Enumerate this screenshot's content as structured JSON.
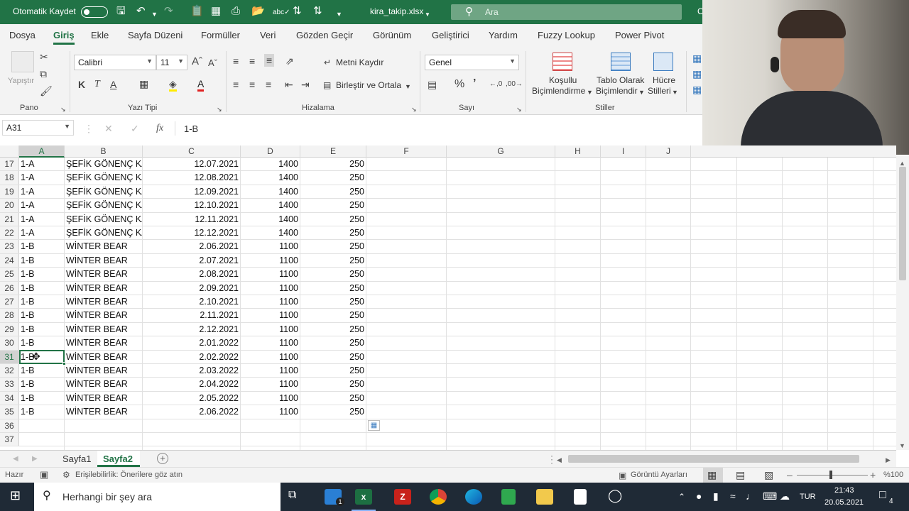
{
  "titlebar": {
    "autosave_label": "Otomatik Kaydet",
    "filename": "kira_takip.xlsx",
    "search_placeholder": "Ara",
    "overflow_char": "C"
  },
  "tabs": [
    "Dosya",
    "Giriş",
    "Ekle",
    "Sayfa Düzeni",
    "Formüller",
    "Veri",
    "Gözden Geçir",
    "Görünüm",
    "Geliştirici",
    "Yardım",
    "Fuzzy Lookup",
    "Power Pivot"
  ],
  "ribbon": {
    "paste_label": "Yapıştır",
    "font_name": "Calibri",
    "font_size": "11",
    "wrap_text": "Metni Kaydır",
    "merge_center": "Birleştir ve Ortala",
    "number_format": "Genel",
    "conditional_format_1": "Koşullu",
    "conditional_format_2": "Biçimlendirme",
    "format_table_1": "Tablo Olarak",
    "format_table_2": "Biçimlendir",
    "cell_styles_1": "Hücre",
    "cell_styles_2": "Stilleri",
    "groups": {
      "clipboard": "Pano",
      "font": "Yazı Tipi",
      "alignment": "Hizalama",
      "number": "Sayı",
      "styles": "Stiller"
    }
  },
  "formula_bar": {
    "name_box": "A31",
    "fx": "fx",
    "value": "1-B"
  },
  "columns": [
    "A",
    "B",
    "C",
    "D",
    "E",
    "F",
    "G",
    "H",
    "I",
    "J"
  ],
  "rows": [
    {
      "n": "17",
      "a": "1-A",
      "b": "ŞEFİK GÖNENÇ KA",
      "c": "12.07.2021",
      "d": "1400",
      "e": "250"
    },
    {
      "n": "18",
      "a": "1-A",
      "b": "ŞEFİK GÖNENÇ KA",
      "c": "12.08.2021",
      "d": "1400",
      "e": "250"
    },
    {
      "n": "19",
      "a": "1-A",
      "b": "ŞEFİK GÖNENÇ KA",
      "c": "12.09.2021",
      "d": "1400",
      "e": "250"
    },
    {
      "n": "20",
      "a": "1-A",
      "b": "ŞEFİK GÖNENÇ KA",
      "c": "12.10.2021",
      "d": "1400",
      "e": "250"
    },
    {
      "n": "21",
      "a": "1-A",
      "b": "ŞEFİK GÖNENÇ KA",
      "c": "12.11.2021",
      "d": "1400",
      "e": "250"
    },
    {
      "n": "22",
      "a": "1-A",
      "b": "ŞEFİK GÖNENÇ KA",
      "c": "12.12.2021",
      "d": "1400",
      "e": "250"
    },
    {
      "n": "23",
      "a": "1-B",
      "b": "WİNTER BEAR",
      "c": "2.06.2021",
      "d": "1100",
      "e": "250"
    },
    {
      "n": "24",
      "a": "1-B",
      "b": "WİNTER BEAR",
      "c": "2.07.2021",
      "d": "1100",
      "e": "250"
    },
    {
      "n": "25",
      "a": "1-B",
      "b": "WİNTER BEAR",
      "c": "2.08.2021",
      "d": "1100",
      "e": "250"
    },
    {
      "n": "26",
      "a": "1-B",
      "b": "WİNTER BEAR",
      "c": "2.09.2021",
      "d": "1100",
      "e": "250"
    },
    {
      "n": "27",
      "a": "1-B",
      "b": "WİNTER BEAR",
      "c": "2.10.2021",
      "d": "1100",
      "e": "250"
    },
    {
      "n": "28",
      "a": "1-B",
      "b": "WİNTER BEAR",
      "c": "2.11.2021",
      "d": "1100",
      "e": "250"
    },
    {
      "n": "29",
      "a": "1-B",
      "b": "WİNTER BEAR",
      "c": "2.12.2021",
      "d": "1100",
      "e": "250"
    },
    {
      "n": "30",
      "a": "1-B",
      "b": "WİNTER BEAR",
      "c": "2.01.2022",
      "d": "1100",
      "e": "250"
    },
    {
      "n": "31",
      "a": "1-B",
      "b": "WİNTER BEAR",
      "c": "2.02.2022",
      "d": "1100",
      "e": "250"
    },
    {
      "n": "32",
      "a": "1-B",
      "b": "WİNTER BEAR",
      "c": "2.03.2022",
      "d": "1100",
      "e": "250"
    },
    {
      "n": "33",
      "a": "1-B",
      "b": "WİNTER BEAR",
      "c": "2.04.2022",
      "d": "1100",
      "e": "250"
    },
    {
      "n": "34",
      "a": "1-B",
      "b": "WİNTER BEAR",
      "c": "2.05.2022",
      "d": "1100",
      "e": "250"
    },
    {
      "n": "35",
      "a": "1-B",
      "b": "WİNTER BEAR",
      "c": "2.06.2022",
      "d": "1100",
      "e": "250"
    },
    {
      "n": "36",
      "a": "",
      "b": "",
      "c": "",
      "d": "",
      "e": ""
    },
    {
      "n": "37",
      "a": "",
      "b": "",
      "c": "",
      "d": "",
      "e": ""
    }
  ],
  "sheets": [
    "Sayfa1",
    "Sayfa2"
  ],
  "active_sheet": "Sayfa2",
  "status": {
    "ready": "Hazır",
    "accessibility": "Erişilebilirlik: Önerilere göz atın",
    "display_settings": "Görüntü Ayarları",
    "zoom": "%100"
  },
  "taskbar": {
    "search_placeholder": "Herhangi bir şey ara",
    "language": "TUR",
    "time": "21:43",
    "date": "20.05.2021",
    "notif_count": "4",
    "mail_badge": "1"
  },
  "colors": {
    "excel_green": "#217346",
    "taskbar": "#1f2a36"
  }
}
